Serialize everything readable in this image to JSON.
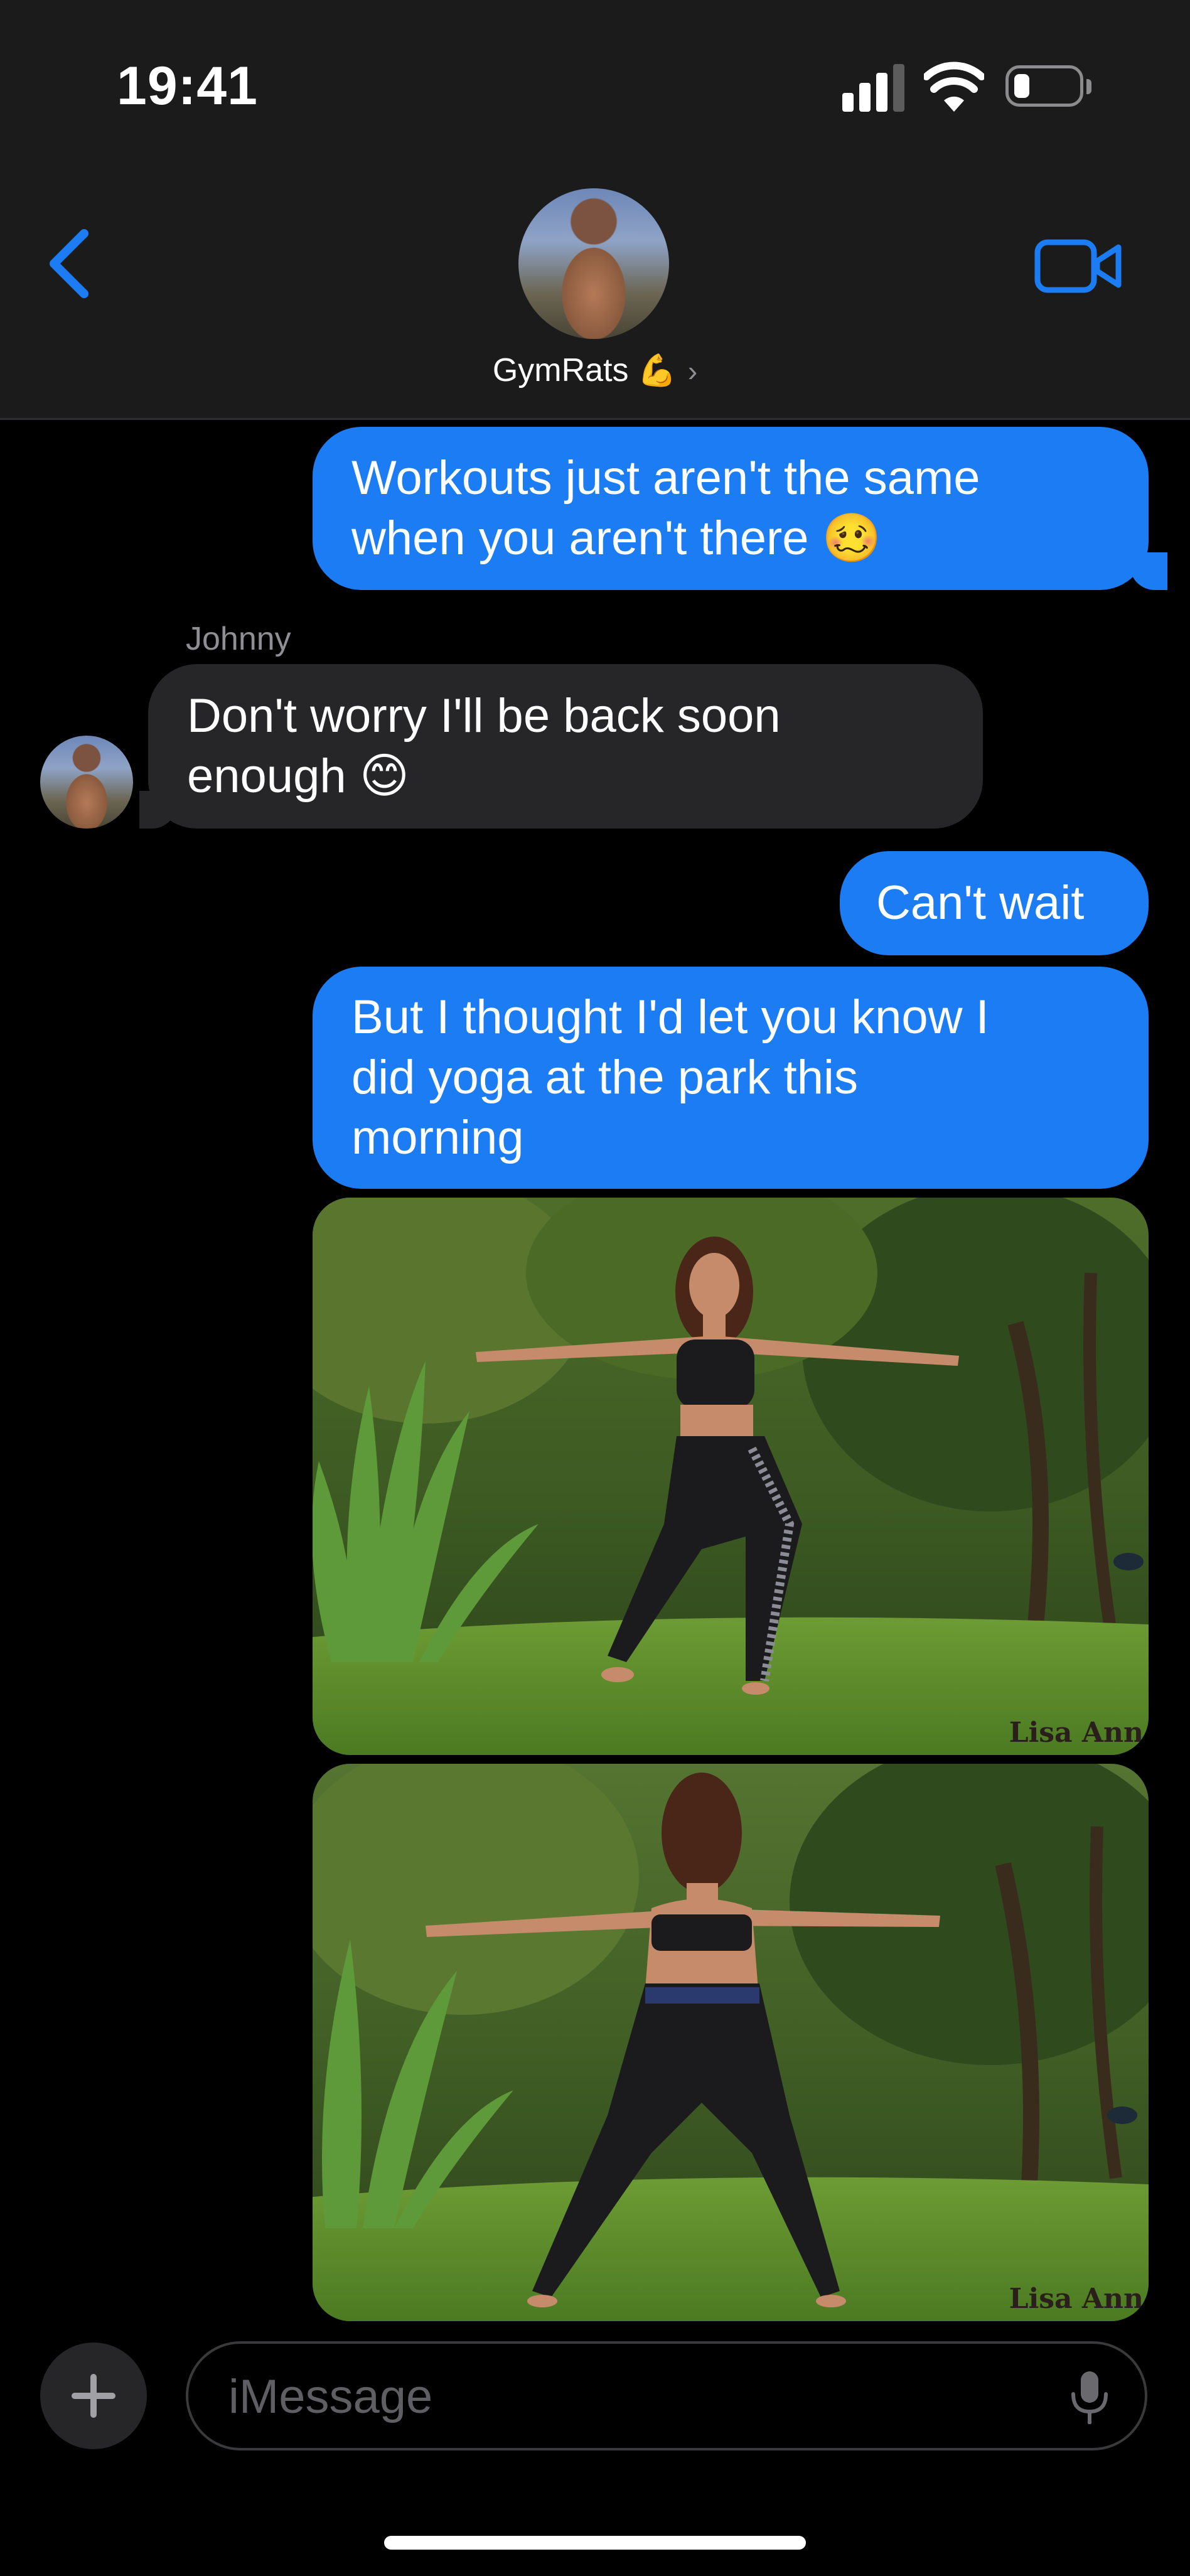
{
  "status_bar": {
    "time": "19:41"
  },
  "header": {
    "group_name": "GymRats",
    "group_emoji": "💪",
    "chevron": "›"
  },
  "messages": [
    {
      "direction": "outgoing",
      "lines": [
        "Workouts just aren't the same",
        "when you aren't there 🥴"
      ]
    },
    {
      "direction": "incoming",
      "sender": "Johnny",
      "lines": [
        "Don't worry I'll be back soon",
        "enough 😊"
      ]
    },
    {
      "direction": "outgoing",
      "lines": [
        "Can't wait"
      ]
    },
    {
      "direction": "outgoing",
      "lines": [
        "But I thought I'd let you know I",
        "did yoga at the park this",
        "morning"
      ]
    },
    {
      "direction": "outgoing",
      "type": "photo",
      "watermark": "Lisa Ann"
    },
    {
      "direction": "outgoing",
      "type": "photo",
      "watermark": "Lisa Ann"
    }
  ],
  "compose": {
    "placeholder": "iMessage"
  },
  "icons": {
    "back": "chevron-left-icon",
    "video": "video-camera-icon",
    "plus": "plus-icon",
    "mic": "microphone-icon"
  },
  "colors": {
    "accent": "#1b7cf4",
    "incoming_bubble": "#262628",
    "header_bg": "#1b1b1b",
    "background": "#000000"
  }
}
